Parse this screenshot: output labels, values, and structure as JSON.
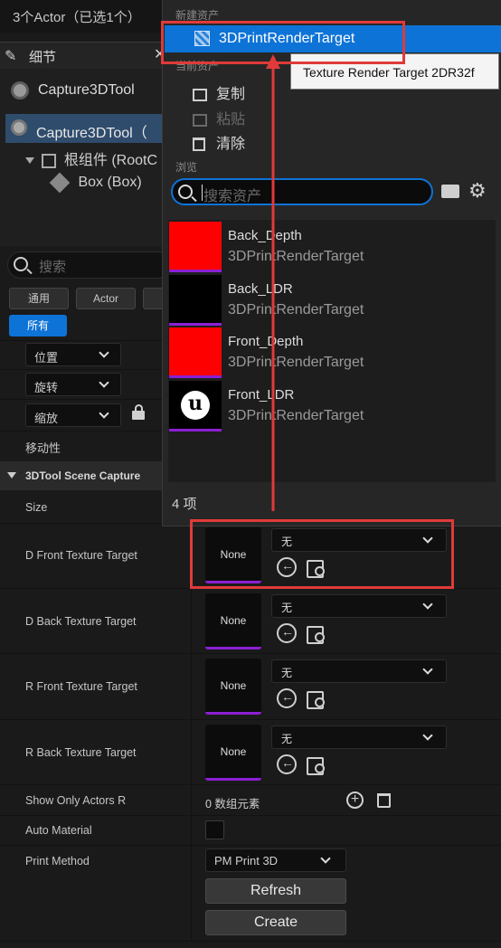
{
  "header": {
    "title": "3个Actor（已选1个）"
  },
  "details_panel": {
    "tab_label": "细节",
    "close_glyph": "✕",
    "actor_name": "Capture3DTool",
    "tree": {
      "selected": "Capture3DTool（",
      "root": "根组件 (RootC",
      "child": "Box (Box)"
    },
    "search_placeholder": "搜索",
    "filters": [
      "通用",
      "Actor",
      "所有"
    ],
    "transform": [
      "位置",
      "旋转",
      "缩放"
    ],
    "mobility_label": "移动性",
    "section_title": "3DTool Scene Capture",
    "properties": {
      "size": "Size",
      "d_front": "D Front Texture Target",
      "d_back": "D Back Texture Target",
      "r_front": "R Front Texture Target",
      "r_back": "R Back Texture Target",
      "show_only": "Show Only Actors R",
      "auto_material": "Auto Material",
      "print_method": "Print Method"
    },
    "texture_thumb_label": "None",
    "texture_select_value": "无",
    "array_count": "0 数组元素",
    "print_method_value": "PM Print 3D",
    "buttons": {
      "refresh": "Refresh",
      "create": "Create"
    }
  },
  "asset_picker": {
    "section_new": "新建资产",
    "new_item": "3DPrintRenderTarget",
    "tooltip": "Texture Render Target 2DR32f",
    "section_current": "当前资产",
    "menu": {
      "copy": "复制",
      "paste": "粘贴",
      "clear": "清除"
    },
    "section_browse": "浏览",
    "search_placeholder": "搜索资产",
    "assets": [
      {
        "name": "Back_Depth",
        "type": "3DPrintRenderTarget",
        "color": "#ff0000"
      },
      {
        "name": "Back_LDR",
        "type": "3DPrintRenderTarget",
        "color": "#000000"
      },
      {
        "name": "Front_Depth",
        "type": "3DPrintRenderTarget",
        "color": "#ff0000"
      },
      {
        "name": "Front_LDR",
        "type": "3DPrintRenderTarget",
        "color": "#000000"
      }
    ],
    "count_label": "4 项"
  },
  "colors": {
    "accent": "#0e73d6",
    "annotation": "#e03a3a",
    "asset_underline": "#8c1fd4"
  },
  "icons": [
    "pencil-icon",
    "close-icon",
    "actor-icon",
    "scene-component-icon",
    "box-icon",
    "search-icon",
    "lock-icon",
    "chevron-down-icon",
    "render-target-icon",
    "copy-icon",
    "paste-icon",
    "trash-icon",
    "folder-icon",
    "gear-icon",
    "reset-arrow-icon",
    "browse-asset-icon",
    "add-icon",
    "unreal-logo-icon"
  ]
}
